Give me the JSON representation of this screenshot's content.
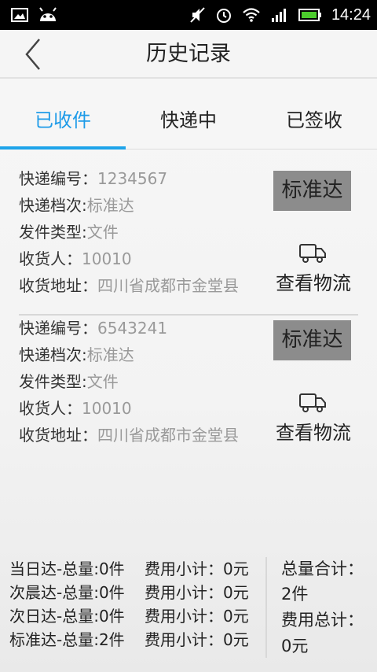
{
  "status_bar": {
    "time": "14:24",
    "icons": [
      "gallery-icon",
      "android-icon",
      "mute-icon",
      "alarm-icon",
      "wifi-icon",
      "signal-icon",
      "battery-icon"
    ]
  },
  "header": {
    "title": "历史记录",
    "back_icon": "back-chevron-icon"
  },
  "tabs": [
    {
      "label": "已收件",
      "active": true
    },
    {
      "label": "快递中",
      "active": false
    },
    {
      "label": "已签收",
      "active": false
    }
  ],
  "records": [
    {
      "number_label": "快递编号：",
      "number": "1234567",
      "level_label": "快递档次:",
      "level": "标准达",
      "type_label": "发件类型:",
      "type": "文件",
      "receiver_label": "收货人：",
      "receiver": "10010",
      "address_label": "收货地址：",
      "address": "四川省成都市金堂县",
      "badge": "标准达",
      "logistics_label": "查看物流"
    },
    {
      "number_label": "快递编号：",
      "number": "6543241",
      "level_label": "快递档次:",
      "level": "标准达",
      "type_label": "发件类型:",
      "type": "文件",
      "receiver_label": "收货人：",
      "receiver": "10010",
      "address_label": "收货地址：",
      "address": "四川省成都市金堂县",
      "badge": "标准达",
      "logistics_label": "查看物流"
    }
  ],
  "summary": {
    "rows": [
      {
        "name": "当日达-总量:0件",
        "fee": "费用小计：0元"
      },
      {
        "name": "次晨达-总量:0件",
        "fee": "费用小计：0元"
      },
      {
        "name": "次日达-总量:0件",
        "fee": "费用小计：0元"
      },
      {
        "name": "标准达-总量:2件",
        "fee": "费用小计：0元"
      }
    ],
    "total_count_label": "总量合计：",
    "total_count": "2件",
    "total_fee_label": "费用总计：",
    "total_fee": "0元"
  },
  "colors": {
    "accent": "#1e9be8",
    "badge_bg": "#8c8c8c",
    "value_gray": "#999999"
  }
}
